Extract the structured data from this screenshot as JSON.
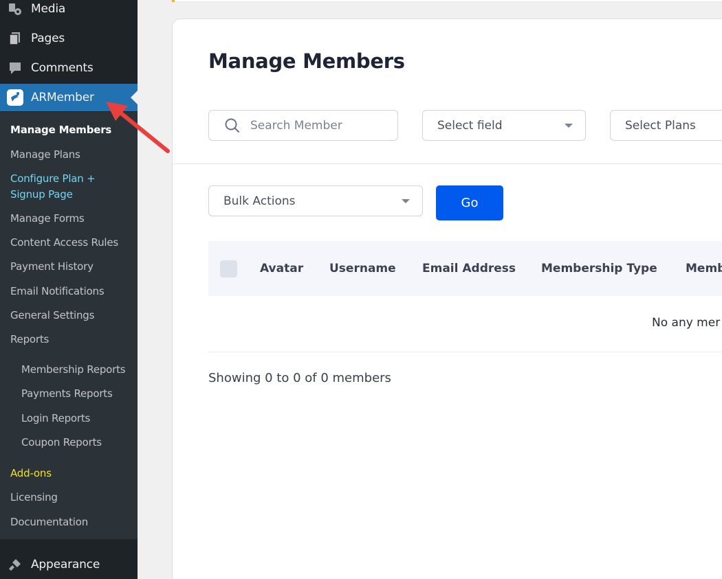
{
  "sidebar": {
    "top_items": [
      {
        "label": "Media",
        "icon": "media-icon"
      },
      {
        "label": "Pages",
        "icon": "pages-icon"
      },
      {
        "label": "Comments",
        "icon": "comments-icon"
      },
      {
        "label": "ARMember",
        "icon": "armember-logo-icon"
      }
    ],
    "submenu": [
      {
        "label": "Manage Members"
      },
      {
        "label": "Manage Plans"
      },
      {
        "label_line1": "Configure Plan +",
        "label_line2": "Signup Page"
      },
      {
        "label": "Manage Forms"
      },
      {
        "label": "Content Access Rules"
      },
      {
        "label": "Payment History"
      },
      {
        "label": "Email Notifications"
      },
      {
        "label": "General Settings"
      },
      {
        "label": "Reports"
      },
      {
        "label": "Membership Reports"
      },
      {
        "label": "Payments Reports"
      },
      {
        "label": "Login Reports"
      },
      {
        "label": "Coupon Reports"
      },
      {
        "label": "Add-ons"
      },
      {
        "label": "Licensing"
      },
      {
        "label": "Documentation"
      }
    ],
    "appearance": {
      "label": "Appearance",
      "icon": "paintbrush-icon"
    }
  },
  "main": {
    "title": "Manage Members",
    "search": {
      "placeholder": "Search Member"
    },
    "select_field": {
      "value": "Select field"
    },
    "select_plans": {
      "value": "Select Plans"
    },
    "bulk_actions": {
      "value": "Bulk Actions"
    },
    "go_label": "Go",
    "table": {
      "headers": [
        "Avatar",
        "Username",
        "Email Address",
        "Membership Type",
        "Memb"
      ],
      "empty_message": "No any mer"
    },
    "showing": "Showing 0 to 0 of 0 members"
  },
  "colors": {
    "sidebar_bg": "#1d2327",
    "submenu_bg": "#2c3338",
    "active_bg": "#2271b1",
    "primary_button": "#005aee",
    "cyan_link": "#72d5f5",
    "yellow_link": "#f0e125",
    "annotation_arrow": "#e8403c"
  }
}
